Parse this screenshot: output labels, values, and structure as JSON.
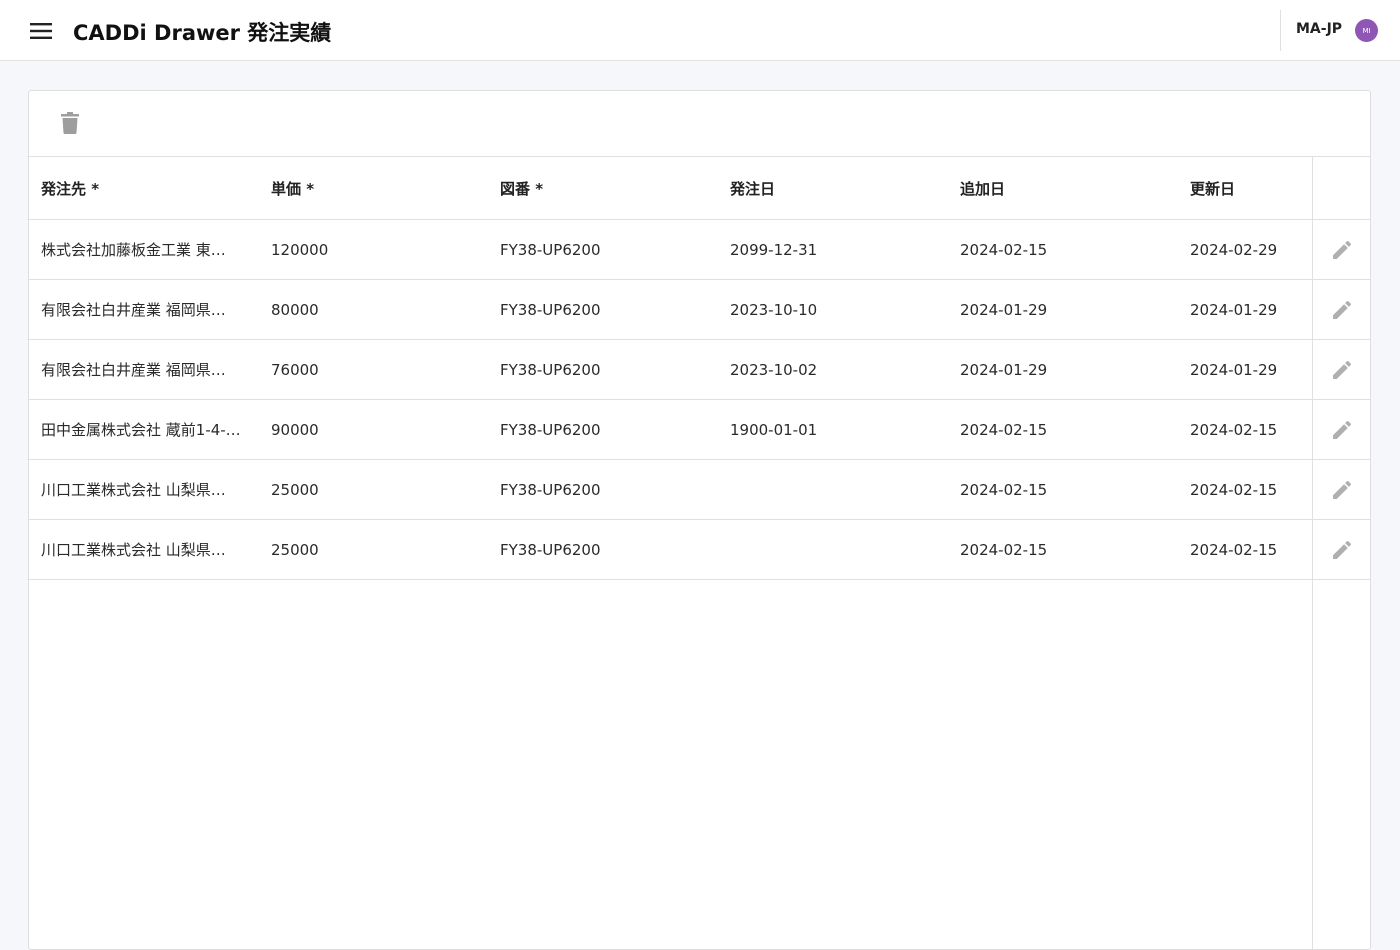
{
  "app": {
    "title": "CADDi Drawer 発注実績",
    "user_name": "MA-JP",
    "avatar_initials": "MI",
    "avatar_color": "#8e57b3"
  },
  "toolbar": {
    "delete_icon": "trash-icon"
  },
  "table": {
    "columns": [
      "発注先 *",
      "単価 *",
      "図番 *",
      "発注日",
      "追加日",
      "更新日"
    ],
    "rows": [
      [
        "株式会社加藤板金工業 東…",
        "120000",
        "FY38-UP6200",
        "2099-12-31",
        "2024-02-15",
        "2024-02-29"
      ],
      [
        "有限会社白井産業 福岡県…",
        "80000",
        "FY38-UP6200",
        "2023-10-10",
        "2024-01-29",
        "2024-01-29"
      ],
      [
        "有限会社白井産業 福岡県…",
        "76000",
        "FY38-UP6200",
        "2023-10-02",
        "2024-01-29",
        "2024-01-29"
      ],
      [
        "田中金属株式会社 蔵前1-4-…",
        "90000",
        "FY38-UP6200",
        "1900-01-01",
        "2024-02-15",
        "2024-02-15"
      ],
      [
        "川口工業株式会社 山梨県…",
        "25000",
        "FY38-UP6200",
        "",
        "2024-02-15",
        "2024-02-15"
      ],
      [
        "川口工業株式会社 山梨県…",
        "25000",
        "FY38-UP6200",
        "",
        "2024-02-15",
        "2024-02-15"
      ]
    ],
    "row_action_icon": "pencil-icon"
  }
}
